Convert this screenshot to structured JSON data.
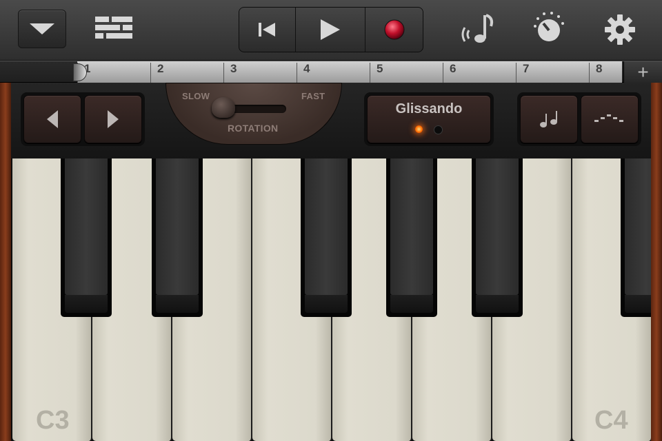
{
  "toolbar": {
    "colors": {
      "bar": "#3b3b3b",
      "record": "#c0102a",
      "icon": "#cfcfcf"
    },
    "icons": [
      "chevron-down-icon",
      "tracks-view-icon",
      "rewind-icon",
      "play-icon",
      "record-icon",
      "smart-instrument-icon",
      "master-effects-icon",
      "gear-icon"
    ]
  },
  "ruler": {
    "bars": [
      "1",
      "2",
      "3",
      "4",
      "5",
      "6",
      "7",
      "8"
    ],
    "add_label": "+"
  },
  "panel": {
    "rotation": {
      "slow_label": "SLOW",
      "fast_label": "FAST",
      "title": "ROTATION",
      "value": "slow"
    },
    "glissando": {
      "label": "Glissando",
      "enabled": true
    },
    "icons": [
      "arrow-left-icon",
      "arrow-right-icon",
      "notes-icon",
      "arpeggio-icon"
    ]
  },
  "keyboard": {
    "labels": {
      "first": "C3",
      "last": "C4"
    }
  }
}
